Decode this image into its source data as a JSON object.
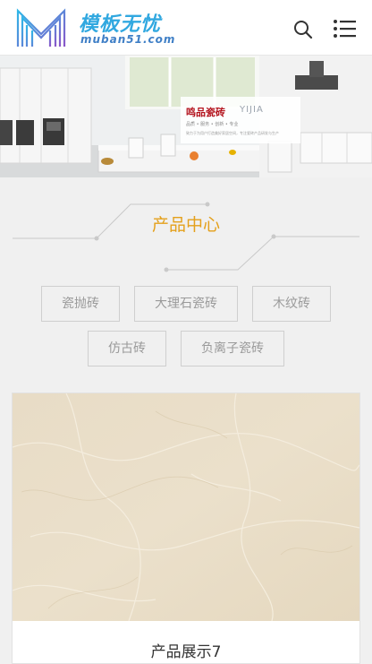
{
  "header": {
    "logo_cn": "模板无忧",
    "logo_url": "muban51.com",
    "search_icon": "search-icon",
    "menu_icon": "menu-list-icon"
  },
  "banner": {
    "brand": "鸣品瓷砖",
    "brand_en": "YIJIA",
    "line1": "品质 • 服务 • 创新 • 专业",
    "line2": "致力于为用户打造美好家居空间，专注瓷砖产品研发与生产",
    "indicator_color": "#e9802f"
  },
  "section": {
    "title": "产品中心",
    "accent_color": "#e4a01b"
  },
  "categories": [
    {
      "label": "瓷抛砖"
    },
    {
      "label": "大理石瓷砖"
    },
    {
      "label": "木纹砖"
    },
    {
      "label": "仿古砖"
    },
    {
      "label": "负离子瓷砖"
    }
  ],
  "products": [
    {
      "name": "产品展示7"
    }
  ]
}
